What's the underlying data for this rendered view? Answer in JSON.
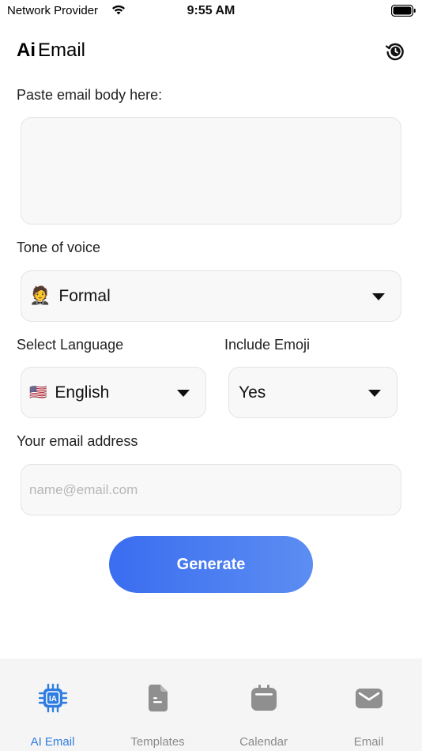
{
  "status_bar": {
    "carrier": "Network Provider",
    "time": "9:55 AM"
  },
  "header": {
    "title_prefix": "Ai",
    "title_suffix": "Email",
    "history_icon": "history-clock-icon"
  },
  "form": {
    "body_label": "Paste email body here:",
    "body_value": "",
    "tone_label": "Tone of voice",
    "tone_emoji": "🤵",
    "tone_value": "Formal",
    "language_label": "Select Language",
    "language_flag": "🇺🇸",
    "language_value": "English",
    "emoji_label": "Include Emoji",
    "emoji_value": "Yes",
    "email_label": "Your email address",
    "email_placeholder": "name@email.com",
    "email_value": ""
  },
  "generate_button": {
    "label": "Generate",
    "gradient_start": "#3a6df0",
    "gradient_end": "#5c8df2"
  },
  "tab_bar": {
    "active_color": "#2f7de0",
    "inactive_color": "#8a8a8a",
    "tabs": [
      {
        "label": "AI Email",
        "icon": "chip-icon",
        "active": true
      },
      {
        "label": "Templates",
        "icon": "document-icon",
        "active": false
      },
      {
        "label": "Calendar",
        "icon": "calendar-icon",
        "active": false
      },
      {
        "label": "Email",
        "icon": "envelope-icon",
        "active": false
      }
    ]
  }
}
